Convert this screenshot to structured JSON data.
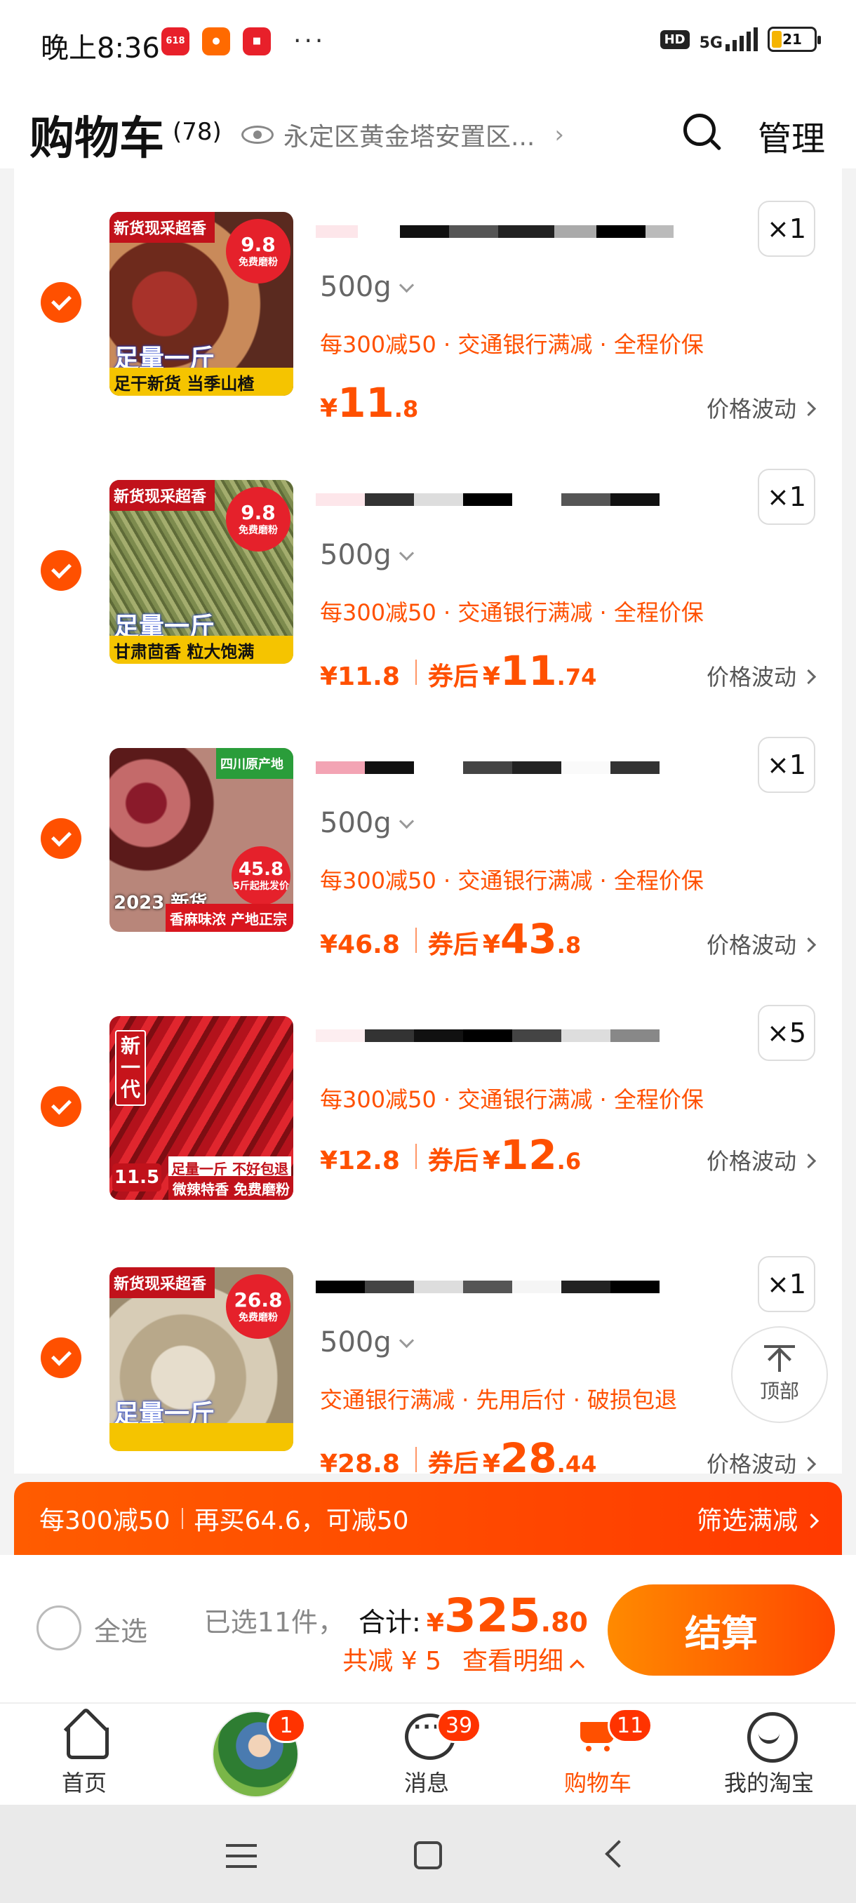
{
  "status_bar": {
    "time": "晚上8:36",
    "hd": "HD",
    "network": "5G",
    "battery": "21"
  },
  "header": {
    "title": "购物车",
    "count": "(78)",
    "location": "永定区黄金塔安置区...",
    "manage": "管理"
  },
  "items": [
    {
      "thumb_top": "新货现采超香",
      "thumb_price": "9.8",
      "thumb_price_sub": "免费磨粉",
      "thumb_mid": "足量一斤",
      "thumb_bottom": "足干新货 当季山楂",
      "quantity": "×1",
      "spec": "500g",
      "promo": "每300减50 · 交通银行满减 · 全程价保",
      "price_int": "11",
      "price_dec": ".8",
      "fluct": "价格波动"
    },
    {
      "thumb_top": "新货现采超香",
      "thumb_price": "9.8",
      "thumb_price_sub": "免费磨粉",
      "thumb_mid": "足量一斤",
      "thumb_bottom": "甘肃茴香 粒大饱满",
      "quantity": "×1",
      "spec": "500g",
      "promo": "每300减50 · 交通银行满减 · 全程价保",
      "price_full": "¥11.8",
      "coupon_label": "券后",
      "coupon_int": "11",
      "coupon_dec": ".74",
      "fluct": "价格波动"
    },
    {
      "thumb_top": "四川原产地",
      "thumb_price": "45.8",
      "thumb_price_sub": "5斤起批发价",
      "thumb_mid": "2023 新货",
      "thumb_bottom": "香麻味浓 产地正宗",
      "quantity": "×1",
      "spec": "500g",
      "promo": "每300减50 · 交通银行满减 · 全程价保",
      "price_full": "¥46.8",
      "coupon_label": "券后",
      "coupon_int": "43",
      "coupon_dec": ".8",
      "fluct": "价格波动"
    },
    {
      "thumb_left": "新一代",
      "thumb_price": "11.5",
      "thumb_mid": "足量一斤 不好包退",
      "thumb_bottom": "微辣特香 免费磨粉",
      "quantity": "×5",
      "promo": "每300减50 · 交通银行满减 · 全程价保",
      "price_full": "¥12.8",
      "coupon_label": "券后",
      "coupon_int": "12",
      "coupon_dec": ".6",
      "fluct": "价格波动"
    },
    {
      "thumb_top": "新货现采超香",
      "thumb_price": "26.8",
      "thumb_price_sub": "免费磨粉",
      "thumb_mid": "足量一斤",
      "quantity": "×1",
      "spec": "500g",
      "promo": "交通银行满减 · 先用后付 · 破损包退",
      "price_full": "¥28.8",
      "coupon_label": "券后",
      "coupon_int": "28",
      "coupon_dec": ".44",
      "fluct": "价格波动"
    }
  ],
  "top_button": "顶部",
  "banner": {
    "left": "每300减50",
    "middle": "再买64.6，可减50",
    "right": "筛选满减"
  },
  "checkout": {
    "select_all": "全选",
    "selected": "已选11件，",
    "total_label": "合计:",
    "total_int": "325",
    "total_dec": ".80",
    "discount": "共减 ¥ 5",
    "details": "查看明细",
    "button": "结算"
  },
  "tabs": [
    {
      "label": "首页",
      "icon": "home-icon"
    },
    {
      "label": "",
      "icon": "avatar",
      "badge": "1"
    },
    {
      "label": "消息",
      "icon": "message-icon",
      "badge": "39"
    },
    {
      "label": "购物车",
      "icon": "cart-icon",
      "badge": "11",
      "active": true
    },
    {
      "label": "我的淘宝",
      "icon": "profile-icon"
    }
  ],
  "colors": {
    "accent": "#ff5000",
    "background": "#f3f3f3"
  }
}
